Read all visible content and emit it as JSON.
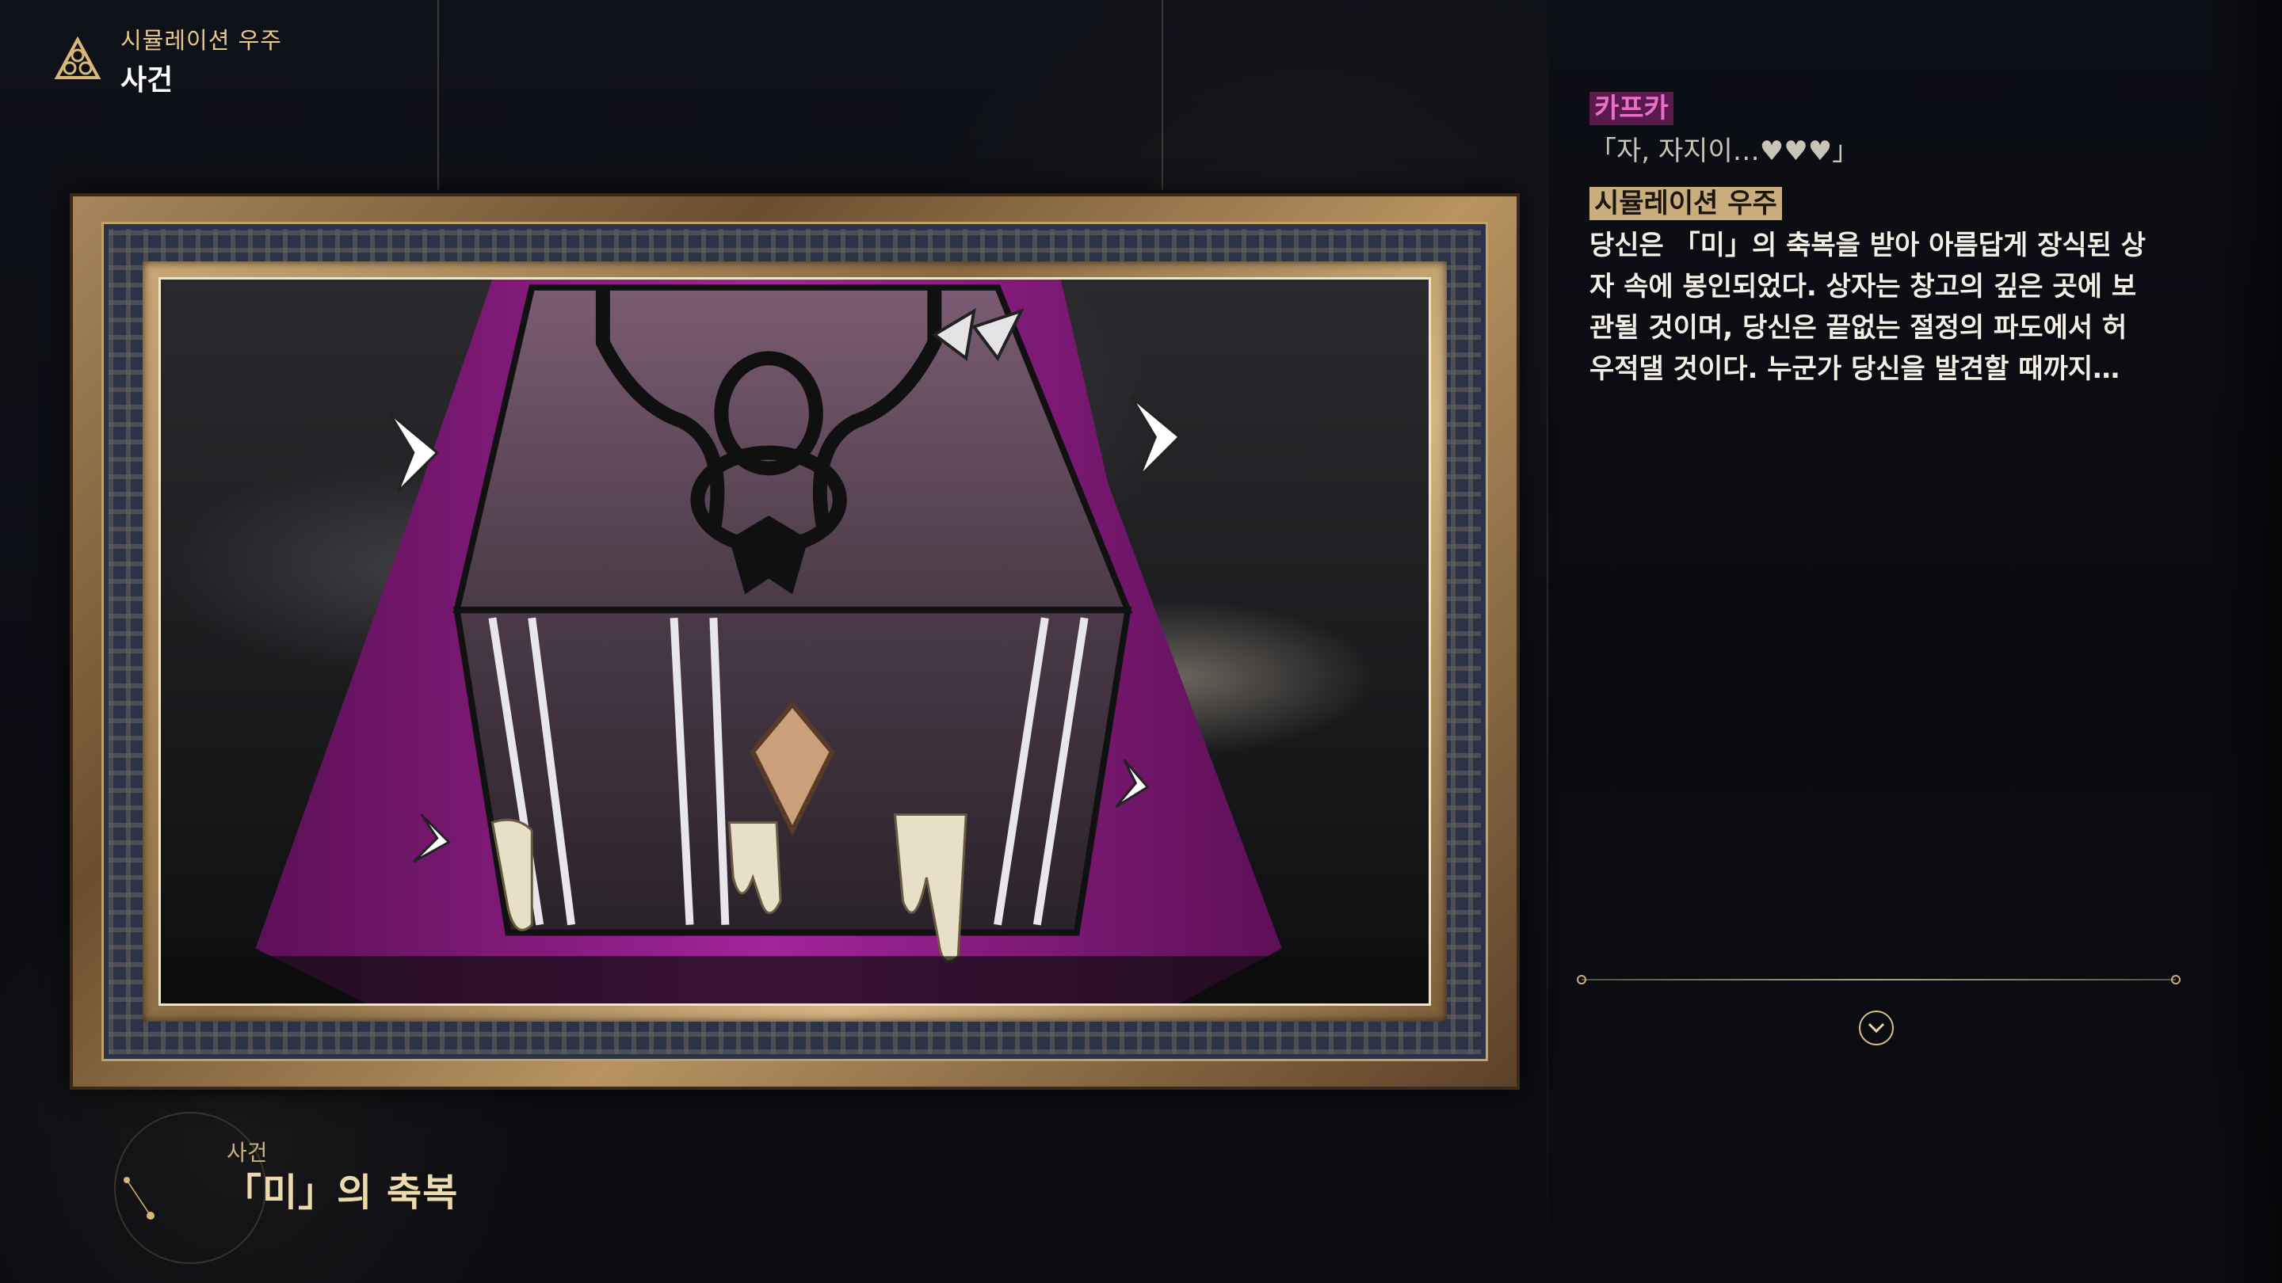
{
  "header": {
    "subtitle": "시뮬레이션 우주",
    "title": "사건",
    "icon": "simulated-universe-logo-icon"
  },
  "event": {
    "label": "사건",
    "title": "「미」의 축복"
  },
  "dialogue": [
    {
      "speaker": "카프카",
      "speaker_color": "#e96fc8",
      "text": "「자, 자지이…♥♥♥」"
    },
    {
      "speaker": "시뮬레이션 우주",
      "speaker_color": "#c9ad7c",
      "lines": [
        "당신은 「미」의 축복을 받아 아름답게 장식된 상",
        "자 속에 봉인되었다. 상자는 창고의 깊은 곳에 보",
        "관될 것이며, 당신은 끝없는 절정의 파도에서 허",
        "우적댈 것이다. 누군가 당신을 발견할 때까지…"
      ]
    }
  ],
  "controls": {
    "next_icon": "chevron-down-circle-icon"
  },
  "colors": {
    "accent_gold": "#c9ad7c",
    "kafka_pink": "#e96fc8",
    "box_magenta": "#8e1c86"
  }
}
